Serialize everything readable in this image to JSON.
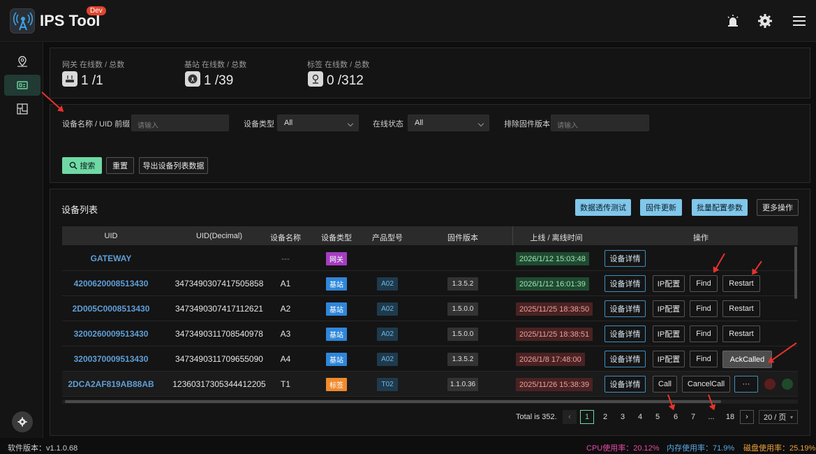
{
  "app": {
    "title": "IPS Tool",
    "badge": "Dev"
  },
  "icons": {
    "logo": "tower-logo-icon",
    "bell": "alarm-icon",
    "settings": "gear-icon",
    "menu": "hamburger-icon"
  },
  "stats": [
    {
      "label": "网关 在线数 / 总数",
      "value": "1 /1",
      "icon": "gateway-icon"
    },
    {
      "label": "基站 在线数 / 总数",
      "value": "1 /39",
      "icon": "basestation-icon"
    },
    {
      "label": "标签 在线数 / 总数",
      "value": "0 /312",
      "icon": "tag-pin-icon"
    }
  ],
  "filters": {
    "name_label": "设备名称 / UID 前缀",
    "name_placeholder": "请输入",
    "type_label": "设备类型",
    "type_value": "All",
    "online_label": "在线状态",
    "online_value": "All",
    "fw_label": "排除固件版本",
    "fw_placeholder": "请输入",
    "search": "搜索",
    "reset": "重置",
    "export": "导出设备列表数据"
  },
  "list": {
    "title": "设备列表",
    "actions": [
      "数据透传测试",
      "固件更新",
      "批量配置参数",
      "更多操作"
    ],
    "headers": [
      "UID",
      "UID(Decimal)",
      "设备名称",
      "设备类型",
      "产品型号",
      "固件版本",
      "上线 / 离线时间",
      "操作"
    ],
    "rows": [
      {
        "uid": "GATEWAY",
        "dec": "",
        "name": "---",
        "type": "网关",
        "kind": "gw",
        "model": "",
        "fw": "",
        "time": "2026/1/12 15:03:48",
        "online": true,
        "ops": [
          "设备详情"
        ]
      },
      {
        "uid": "4200620008513430",
        "dec": "3473490307417505858",
        "name": "A1",
        "type": "基站",
        "kind": "bs",
        "model": "A02",
        "fw": "1.3.5.2",
        "time": "2026/1/12 16:01:39",
        "online": true,
        "ops": [
          "设备详情",
          "IP配置",
          "Find",
          "Restart"
        ]
      },
      {
        "uid": "2D005C0008513430",
        "dec": "3473490307417112621",
        "name": "A2",
        "type": "基站",
        "kind": "bs",
        "model": "A02",
        "fw": "1.5.0.0",
        "time": "2025/11/25 18:38:50",
        "online": false,
        "ops": [
          "设备详情",
          "IP配置",
          "Find",
          "Restart"
        ]
      },
      {
        "uid": "3200260009513430",
        "dec": "3473490311708540978",
        "name": "A3",
        "type": "基站",
        "kind": "bs",
        "model": "A02",
        "fw": "1.5.0.0",
        "time": "2025/11/25 18:38:51",
        "online": false,
        "ops": [
          "设备详情",
          "IP配置",
          "Find",
          "Restart"
        ]
      },
      {
        "uid": "3200370009513430",
        "dec": "3473490311709655090",
        "name": "A4",
        "type": "基站",
        "kind": "bs",
        "model": "A02",
        "fw": "1.3.5.2",
        "time": "2026/1/8 17:48:00",
        "online": false,
        "ops": [
          "设备详情",
          "IP配置",
          "Find"
        ]
      },
      {
        "uid": "2DCA2AF819AB88AB",
        "dec": "12360317305344412205",
        "name": "T1",
        "type": "标签",
        "kind": "tag",
        "model": "T02",
        "fw": "1.1.0.36",
        "time": "2025/11/26 15:38:39",
        "online": false,
        "ops": [
          "设备详情",
          "Call",
          "CancelCall",
          "···"
        ]
      }
    ],
    "tooltip": "AckCalled"
  },
  "pagination": {
    "total": "Total is 352.",
    "pages": [
      "1",
      "2",
      "3",
      "4",
      "5",
      "6",
      "7",
      "...",
      "18"
    ],
    "current": "1",
    "size": "20 / 页"
  },
  "status": {
    "version": "软件版本：v1.1.0.68",
    "cpu": "CPU使用率：20.12%",
    "mem": "内存使用率：71.9%",
    "disk": "磁盘使用率：25.19%"
  },
  "colors": {
    "accent": "#6fd9a6",
    "primary": "#80c7ea",
    "cpu": "#e84aa8",
    "mem": "#5aa9e6",
    "disk": "#f0a13c",
    "annotation": "#e8322c"
  }
}
